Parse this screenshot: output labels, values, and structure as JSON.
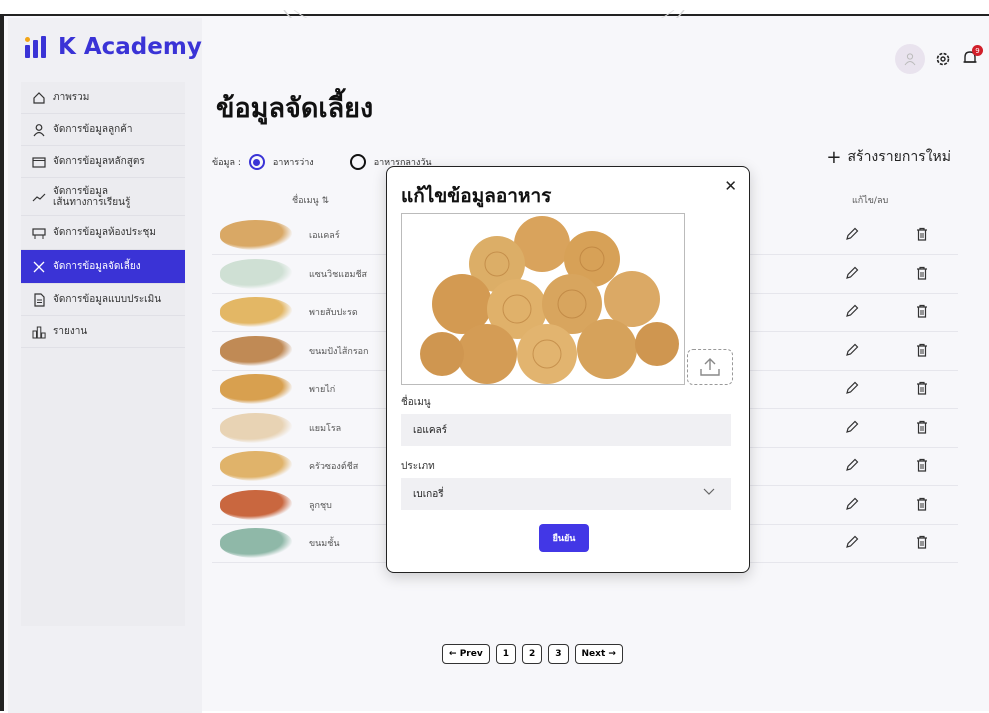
{
  "app": {
    "brand": "K Academy"
  },
  "sidebar": {
    "items": [
      {
        "label": "ภาพรวม",
        "icon": "home-icon"
      },
      {
        "label": "จัดการข้อมูลลูกค้า",
        "icon": "user-icon"
      },
      {
        "label": "จัดการข้อมูลหลักสูตร",
        "icon": "folder-icon"
      },
      {
        "label": "จัดการข้อมูล\nเส้นทางการเรียนรู้",
        "icon": "trend-icon"
      },
      {
        "label": "จัดการข้อมูลห้องประชุม",
        "icon": "meeting-icon"
      },
      {
        "label": "จัดการข้อมูลจัดเลี้ยง",
        "icon": "utensils-icon",
        "active": true
      },
      {
        "label": "จัดการข้อมูลแบบประเมิน",
        "icon": "document-icon"
      },
      {
        "label": "รายงาน",
        "icon": "report-icon"
      }
    ]
  },
  "header": {
    "notification_count": "9"
  },
  "page": {
    "title": "ข้อมูลจัดเลี้ยง",
    "filter_label": "ข้อมูล :",
    "filter_options": [
      "อาหารว่าง",
      "อาหารกลางวัน"
    ],
    "add_new": "สร้างรายการใหม่",
    "col_menu": "ชื่อเมนู",
    "col_actions": "แก้ไข/ลบ"
  },
  "table": {
    "rows": [
      {
        "name": "เอแคลร์",
        "color": "#d9a865"
      },
      {
        "name": "แซนวิชแฮมชีส",
        "color": "#cfe0d4"
      },
      {
        "name": "พายสับปะรด",
        "color": "#e3b765"
      },
      {
        "name": "ขนมปังไส้กรอก",
        "color": "#c08a55"
      },
      {
        "name": "พายไก่",
        "color": "#d8a04f"
      },
      {
        "name": "แยมโรล",
        "color": "#e8d3b4"
      },
      {
        "name": "ครัวซองต์ชีส",
        "color": "#e0b36a"
      },
      {
        "name": "ลูกชุบ",
        "color": "#c9673f"
      },
      {
        "name": "ขนมชั้น",
        "color": "#8fb8a8"
      }
    ]
  },
  "pagination": {
    "prev": "Prev",
    "pages": [
      "1",
      "2",
      "3"
    ],
    "next": "Next"
  },
  "modal": {
    "title": "แก้ไขข้อมูลอาหาร",
    "name_label": "ชื่อเมนู",
    "name_value": "เอแคลร์",
    "type_label": "ประเภท",
    "type_value": "เบเกอรี่",
    "confirm": "ยืนยัน"
  },
  "colors": {
    "accent": "#3a33d6",
    "button": "#4237e6",
    "badge": "#d11f2a"
  }
}
